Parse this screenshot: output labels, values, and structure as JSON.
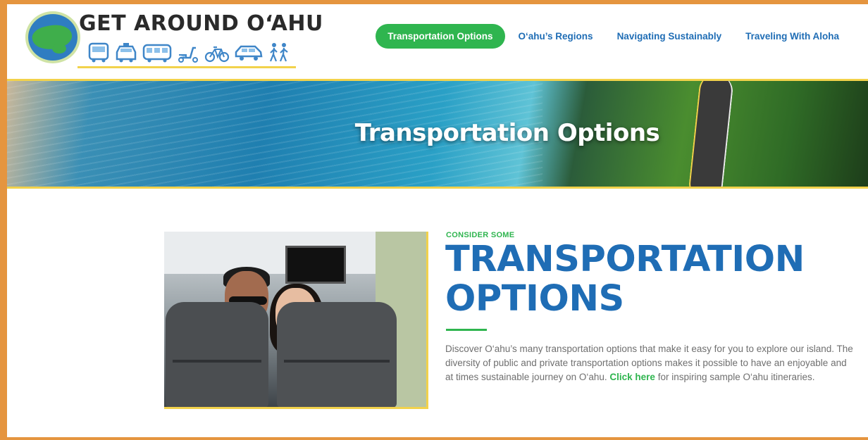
{
  "brand": {
    "logo_title": "GET AROUND O‘AHU",
    "logo_icons": [
      "bus-icon",
      "taxi-icon",
      "van-icon",
      "scooter-icon",
      "bicycle-icon",
      "car-icon",
      "walking-icon"
    ]
  },
  "nav": {
    "items": [
      {
        "label": "Transportation Options",
        "active": true
      },
      {
        "label": "O‘ahu’s Regions",
        "active": false
      },
      {
        "label": "Navigating Sustainably",
        "active": false
      },
      {
        "label": "Traveling With Aloha",
        "active": false
      }
    ]
  },
  "hero": {
    "title": "Transportation Options"
  },
  "section": {
    "kicker": "CONSIDER SOME",
    "heading_line1": "TRANSPORTATION",
    "heading_line2": "OPTIONS",
    "paragraph_before": "Discover O‘ahu’s many transportation options that make it easy for you to explore our island. The diversity of public and private transportation options makes it possible to have an enjoyable and at times sustainable journey on O‘ahu. ",
    "link_text": "Click here",
    "paragraph_after": " for inspiring sample O‘ahu itineraries."
  },
  "colors": {
    "primary_blue": "#1f6db5",
    "accent_green": "#2fb54f",
    "accent_yellow": "#f2d24b",
    "frame_orange": "#e5953f"
  }
}
